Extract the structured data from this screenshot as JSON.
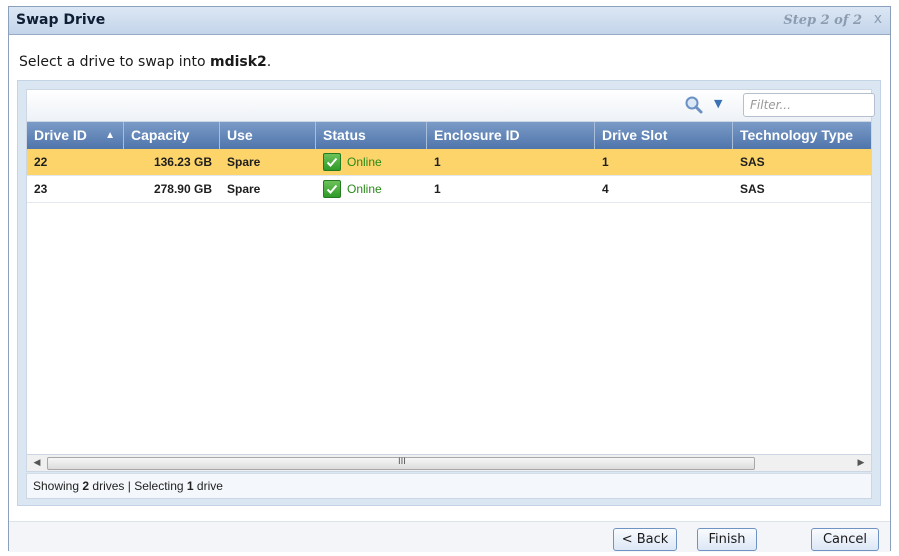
{
  "dialog": {
    "title": "Swap Drive",
    "step": "Step 2 of 2",
    "close": "x"
  },
  "instruction": {
    "prefix": "Select a drive to swap into ",
    "target": "mdisk2",
    "suffix": "."
  },
  "filter": {
    "placeholder": "Filter..."
  },
  "columns": [
    "Drive ID",
    "Capacity",
    "Use",
    "Status",
    "Enclosure ID",
    "Drive Slot",
    "Technology Type"
  ],
  "sort": {
    "column": "Drive ID",
    "direction": "ascending"
  },
  "rows": [
    {
      "drive_id": "22",
      "capacity": "136.23 GB",
      "use": "Spare",
      "status": "Online",
      "enclosure_id": "1",
      "drive_slot": "1",
      "technology_type": "SAS",
      "selected": true
    },
    {
      "drive_id": "23",
      "capacity": "278.90 GB",
      "use": "Spare",
      "status": "Online",
      "enclosure_id": "1",
      "drive_slot": "4",
      "technology_type": "SAS",
      "selected": false
    }
  ],
  "statusbar": {
    "prefix": "Showing ",
    "count": "2",
    "mid": " drives | Selecting ",
    "selected": "1",
    "suffix": " drive"
  },
  "scrollbar": {
    "grip": "III"
  },
  "buttons": {
    "back": "< Back",
    "finish": "Finish",
    "cancel": "Cancel"
  },
  "colors": {
    "header": "#5b80b4",
    "selected_row": "#fcd46a",
    "status_online": "#2a8a1a"
  },
  "icons": {
    "search": "search-icon",
    "dropdown": "chevron-down-icon",
    "status": "checkbox-check-icon"
  }
}
